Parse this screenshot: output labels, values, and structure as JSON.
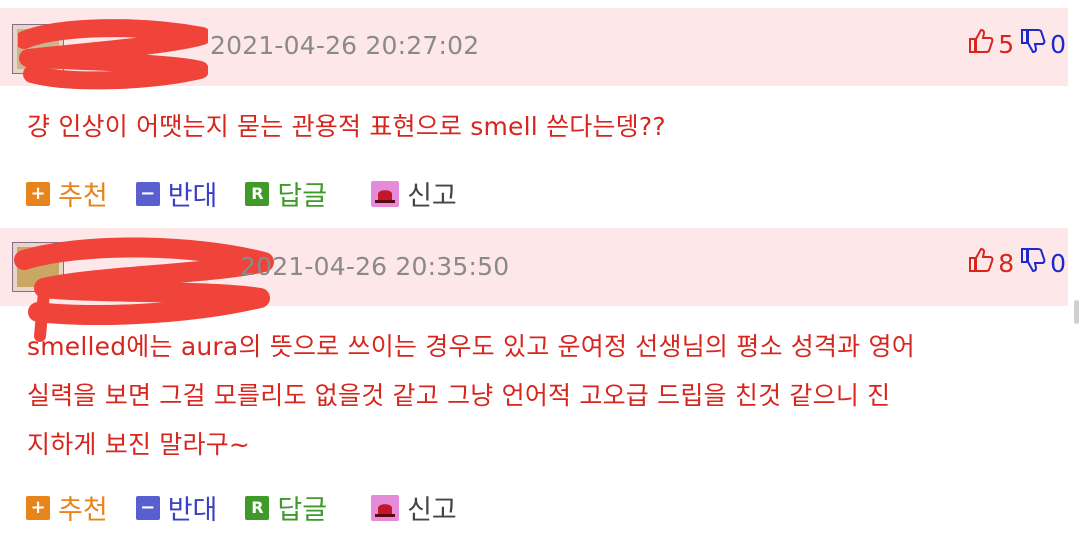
{
  "comments": [
    {
      "timestamp": "2021-04-26 20:27:02",
      "upvotes": "5",
      "downvotes": "0",
      "text_lines": [
        "걍 인상이 어땟는지 묻는 관용적 표현으로 smell 쓴다는뎅??"
      ],
      "actions": {
        "recommend": "추천",
        "oppose": "반대",
        "reply": "답글",
        "report": "신고"
      }
    },
    {
      "timestamp": "2021-04-26 20:35:50",
      "upvotes": "8",
      "downvotes": "0",
      "text_lines": [
        "smelled에는 aura의 뜻으로 쓰이는 경우도 있고 운여정 선생님의 평소 성격과 영어",
        "실력을 보면 그걸 모를리도 없을것 같고 그냥 언어적 고오급 드립을 친것 같으니 진",
        "지하게 보진 말라구~"
      ],
      "actions": {
        "recommend": "추천",
        "oppose": "반대",
        "reply": "답글",
        "report": "신고"
      }
    }
  ],
  "icons": {
    "recommend": "plus-icon",
    "oppose": "minus-icon",
    "reply": "reply-r-icon",
    "report": "siren-icon",
    "upvote": "thumbs-up-icon",
    "downvote": "thumbs-down-icon"
  },
  "colors": {
    "header_bg": "#fde7e9",
    "comment_text": "#d7261e",
    "upvote": "#d7261e",
    "downvote": "#1d29c9",
    "recommend": "#e8841c",
    "oppose": "#3a40c2",
    "reply": "#3f9a2a"
  }
}
